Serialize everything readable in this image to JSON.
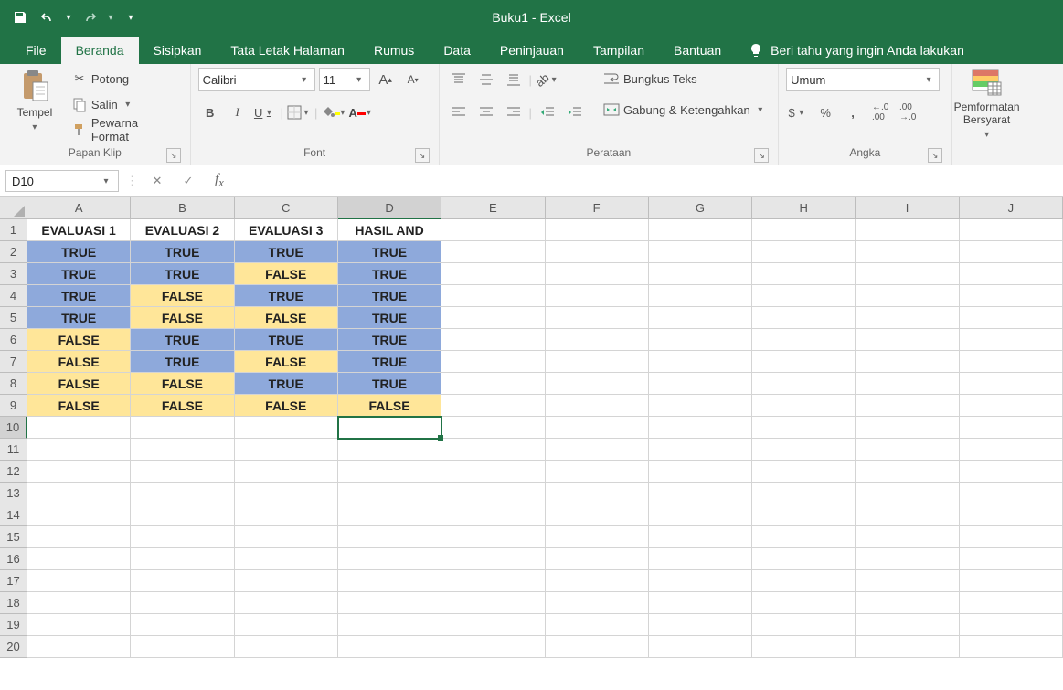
{
  "title": "Buku1 - Excel",
  "tabs": [
    "File",
    "Beranda",
    "Sisipkan",
    "Tata Letak Halaman",
    "Rumus",
    "Data",
    "Peninjauan",
    "Tampilan",
    "Bantuan"
  ],
  "active_tab": 1,
  "tell_me": "Beri tahu yang ingin Anda lakukan",
  "ribbon": {
    "clipboard": {
      "paste": "Tempel",
      "cut": "Potong",
      "copy": "Salin",
      "painter": "Pewarna Format",
      "label": "Papan Klip"
    },
    "font": {
      "name": "Calibri",
      "size": "11",
      "label": "Font"
    },
    "alignment": {
      "wrap": "Bungkus Teks",
      "merge": "Gabung & Ketengahkan",
      "label": "Perataan"
    },
    "number": {
      "format": "Umum",
      "label": "Angka",
      "currency": "$",
      "percent": "%",
      "comma": ",",
      "inc": ".0",
      "dec": ".00"
    },
    "cond": {
      "label": "Pemformatan Bersyarat"
    }
  },
  "name_box": "D10",
  "formula": "",
  "columns": [
    "A",
    "B",
    "C",
    "D",
    "E",
    "F",
    "G",
    "H",
    "I",
    "J"
  ],
  "rows": 20,
  "selected": {
    "col": 3,
    "row": 10
  },
  "highlighted_col": 3,
  "highlighted_row": 10,
  "sheet": {
    "headers": [
      "EVALUASI 1",
      "EVALUASI 2",
      "EVALUASI 3",
      "HASIL AND"
    ],
    "data": [
      {
        "c": [
          "TRUE",
          "TRUE",
          "TRUE",
          "TRUE"
        ],
        "s": [
          "blue",
          "blue",
          "blue",
          "blue"
        ]
      },
      {
        "c": [
          "TRUE",
          "TRUE",
          "FALSE",
          "TRUE"
        ],
        "s": [
          "blue",
          "blue",
          "yellow",
          "blue"
        ]
      },
      {
        "c": [
          "TRUE",
          "FALSE",
          "TRUE",
          "TRUE"
        ],
        "s": [
          "blue",
          "yellow",
          "blue",
          "blue"
        ]
      },
      {
        "c": [
          "TRUE",
          "FALSE",
          "FALSE",
          "TRUE"
        ],
        "s": [
          "blue",
          "yellow",
          "yellow",
          "blue"
        ]
      },
      {
        "c": [
          "FALSE",
          "TRUE",
          "TRUE",
          "TRUE"
        ],
        "s": [
          "yellow",
          "blue",
          "blue",
          "blue"
        ]
      },
      {
        "c": [
          "FALSE",
          "TRUE",
          "FALSE",
          "TRUE"
        ],
        "s": [
          "yellow",
          "blue",
          "yellow",
          "blue"
        ]
      },
      {
        "c": [
          "FALSE",
          "FALSE",
          "TRUE",
          "TRUE"
        ],
        "s": [
          "yellow",
          "yellow",
          "blue",
          "blue"
        ]
      },
      {
        "c": [
          "FALSE",
          "FALSE",
          "FALSE",
          "FALSE"
        ],
        "s": [
          "yellow",
          "yellow",
          "yellow",
          "yellow"
        ]
      }
    ]
  }
}
